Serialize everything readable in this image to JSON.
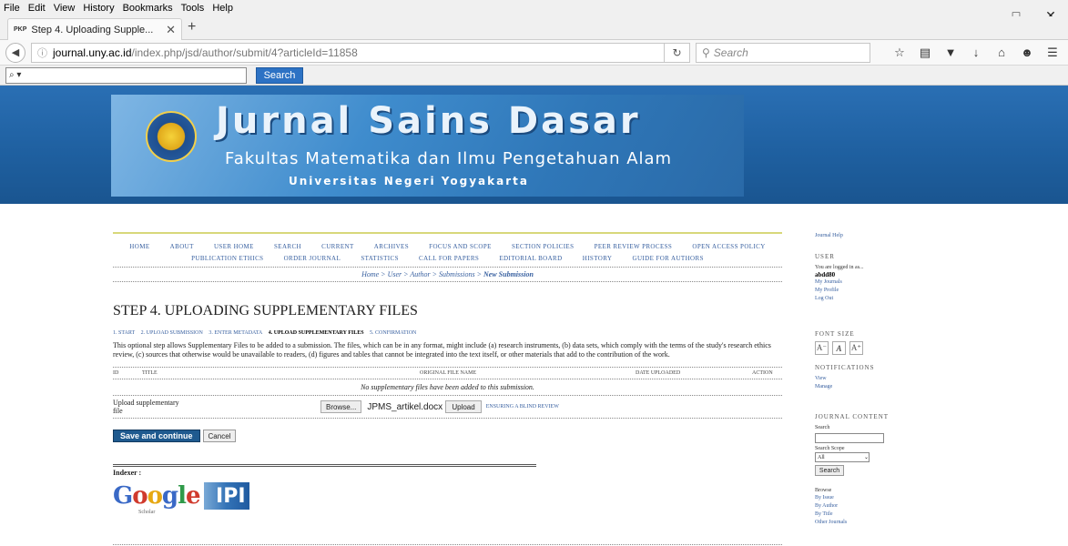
{
  "browser": {
    "menu": [
      "File",
      "Edit",
      "View",
      "History",
      "Bookmarks",
      "Tools",
      "Help"
    ],
    "tab_favicon": "PKP",
    "tab_title": "Step 4. Uploading Supple...",
    "url_host": "journal.uny.ac.id",
    "url_path": "/index.php/jsd/author/submit/4?articleId=11858",
    "search_placeholder": "Search",
    "toolbar_input": "⌕ ▾",
    "toolbar_search": "Search"
  },
  "banner": {
    "title": "Jurnal Sains Dasar",
    "faculty": "Fakultas Matematika dan Ilmu Pengetahuan Alam",
    "university": "Universitas Negeri Yogyakarta"
  },
  "nav": {
    "row1": [
      "Home",
      "About",
      "User Home",
      "Search",
      "Current",
      "Archives",
      "Focus and Scope",
      "Section Policies",
      "Peer Review Process",
      "Open Access Policy"
    ],
    "row2": [
      "Publication Ethics",
      "Order Journal",
      "Statistics",
      "Call for Papers",
      "Editorial Board",
      "History",
      "Guide for Authors"
    ]
  },
  "breadcrumb": [
    "Home",
    "User",
    "Author",
    "Submissions",
    "New Submission"
  ],
  "page": {
    "heading": "STEP 4. UPLOADING SUPPLEMENTARY FILES",
    "steps": [
      "1. START",
      "2. UPLOAD SUBMISSION",
      "3. ENTER METADATA",
      "4. UPLOAD SUPPLEMENTARY FILES",
      "5. CONFIRMATION"
    ],
    "description": "This optional step allows Supplementary Files to be added to a submission. The files, which can be in any format, might include (a) research instruments, (b) data sets, which comply with the terms of the study's research ethics review, (c) sources that otherwise would be unavailable to readers, (d) figures and tables that cannot be integrated into the text itself, or other materials that add to the contribution of the work.",
    "columns": [
      "ID",
      "Title",
      "Original file name",
      "Date uploaded",
      "Action"
    ],
    "empty_text": "No supplementary files have been added to this submission.",
    "upload_label": "Upload supplementary file",
    "browse_label": "Browse...",
    "file_name": "JPMS_artikel.docx",
    "upload_button": "Upload",
    "blind_review": "Ensuring a Blind Review",
    "save_button": "Save and continue",
    "cancel_button": "Cancel",
    "indexer_label": "Indexer :",
    "scholar_label": "Scholar",
    "ipi_label": "IPI"
  },
  "sidebar": {
    "journal_help": "Journal Help",
    "user_title": "User",
    "logged_in": "You are logged in as...",
    "username": "abdd80",
    "links": [
      "My Journals",
      "My Profile",
      "Log Out"
    ],
    "font_size_title": "Font Size",
    "notifications_title": "Notifications",
    "notif_links": [
      "View",
      "Manage"
    ],
    "journal_content_title": "Journal Content",
    "search_label": "Search",
    "scope_label": "Search Scope",
    "scope_value": "All",
    "search_button": "Search",
    "browse_label": "Browse",
    "browse_links": [
      "By Issue",
      "By Author",
      "By Title",
      "Other Journals"
    ]
  }
}
